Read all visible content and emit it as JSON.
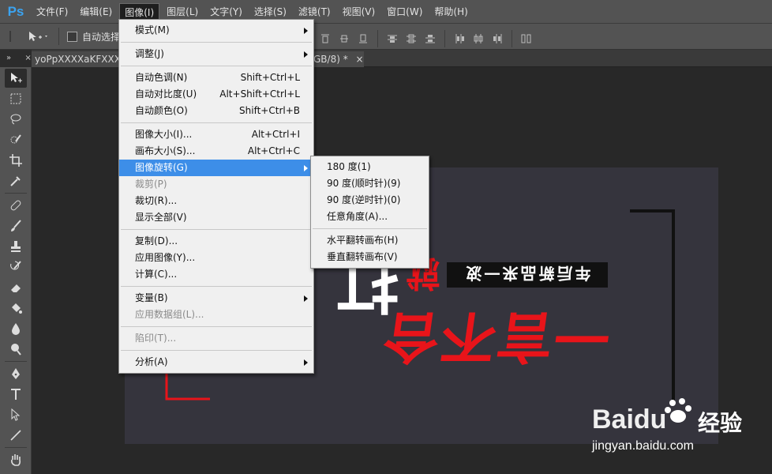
{
  "app": {
    "logo": "Ps"
  },
  "menubar": {
    "items": [
      "文件(F)",
      "编辑(E)",
      "图像(I)",
      "图层(L)",
      "文字(Y)",
      "选择(S)",
      "滤镜(T)",
      "视图(V)",
      "窗口(W)",
      "帮助(H)"
    ]
  },
  "options": {
    "auto_select": "自动选择："
  },
  "tabs": {
    "panel_collapse": "»",
    "tab1": "yoPpXXXXaKFXXXX",
    "tab2": "GB/8) *",
    "close": "×"
  },
  "image_menu": {
    "mode": "模式(M)",
    "adjust": "调整(J)",
    "auto_tone": "自动色调(N)",
    "auto_tone_sc": "Shift+Ctrl+L",
    "auto_contrast": "自动对比度(U)",
    "auto_contrast_sc": "Alt+Shift+Ctrl+L",
    "auto_color": "自动颜色(O)",
    "auto_color_sc": "Shift+Ctrl+B",
    "image_size": "图像大小(I)...",
    "image_size_sc": "Alt+Ctrl+I",
    "canvas_size": "画布大小(S)...",
    "canvas_size_sc": "Alt+Ctrl+C",
    "rotation": "图像旋转(G)",
    "crop": "裁剪(P)",
    "trim": "裁切(R)...",
    "reveal_all": "显示全部(V)",
    "duplicate": "复制(D)...",
    "apply_image": "应用图像(Y)...",
    "calculations": "计算(C)...",
    "variables": "变量(B)",
    "apply_data_set": "应用数据组(L)...",
    "trap": "陷印(T)...",
    "analysis": "分析(A)"
  },
  "rotation_menu": {
    "r180": "180 度(1)",
    "r90cw": "90 度(顺时针)(9)",
    "r90ccw": "90 度(逆时针)(0)",
    "arbitrary": "任意角度(A)...",
    "flip_h": "水平翻转画布(H)",
    "flip_v": "垂直翻转画布(V)"
  },
  "document_art": {
    "banner": "年后新品来一波",
    "red_text": "一言不合",
    "red_small": "就",
    "white_text": "打"
  },
  "watermark": {
    "brand": "Baidu",
    "cn": "经验",
    "url": "jingyan.baidu.com"
  },
  "colors": {
    "highlight": "#3d8ee8",
    "logo": "#3ba3f0",
    "red": "#e8141a"
  }
}
